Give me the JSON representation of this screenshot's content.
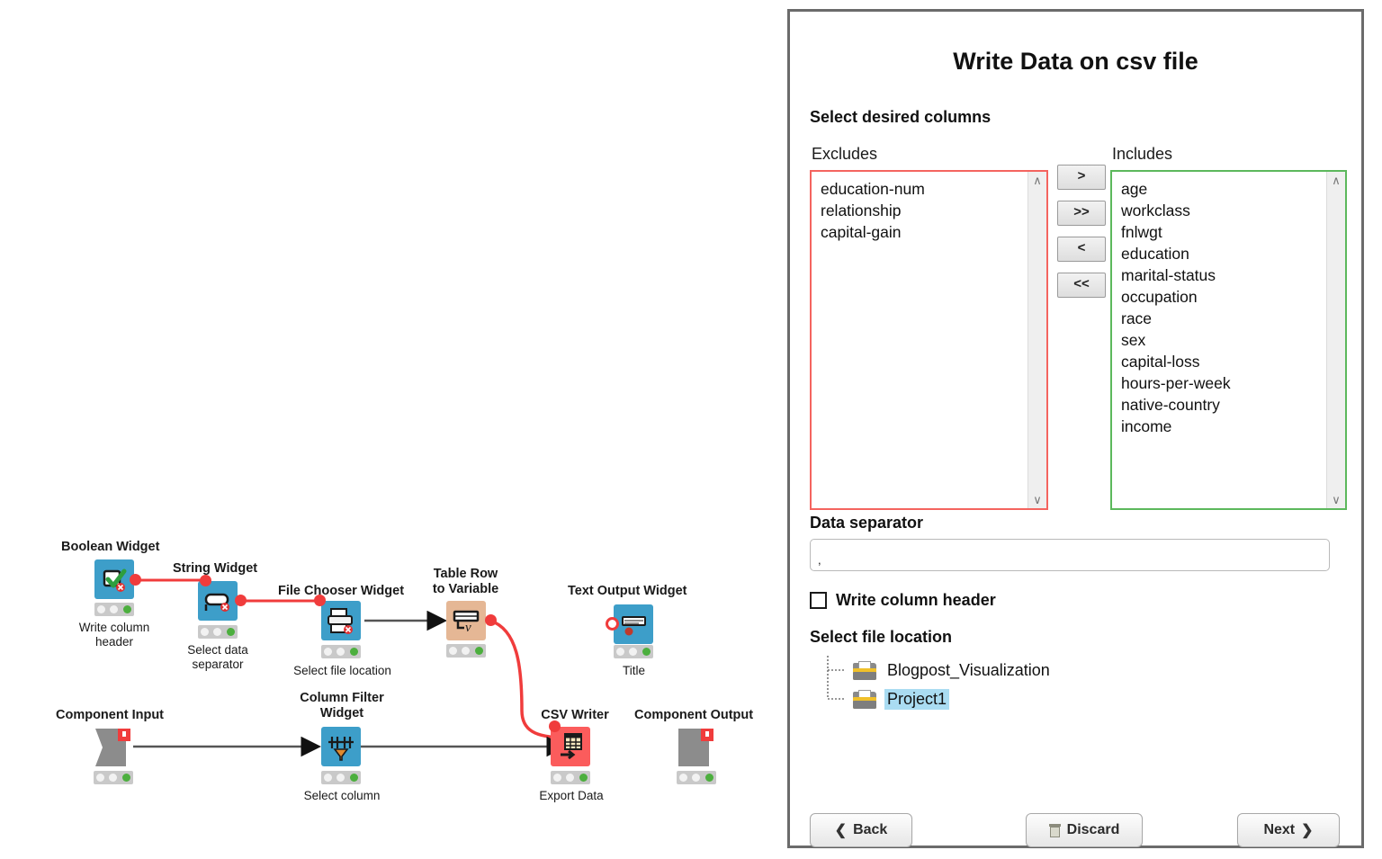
{
  "workflow": {
    "nodes": [
      {
        "id": "boolean-widget",
        "title": "Boolean Widget",
        "label": "Write column\nheader",
        "color": "blue"
      },
      {
        "id": "string-widget",
        "title": "String Widget",
        "label": "Select data\nseparator",
        "color": "blue"
      },
      {
        "id": "file-chooser-widget",
        "title": "File Chooser Widget",
        "label": "Select file location",
        "color": "blue"
      },
      {
        "id": "table-row-to-variable",
        "title": "Table Row\nto Variable",
        "label": "",
        "color": "tan"
      },
      {
        "id": "text-output-widget",
        "title": "Text Output Widget",
        "label": "Title",
        "color": "blue"
      },
      {
        "id": "component-input",
        "title": "Component Input",
        "label": "",
        "color": "gray"
      },
      {
        "id": "column-filter-widget",
        "title": "Column Filter\nWidget",
        "label": "Select column",
        "color": "blue"
      },
      {
        "id": "csv-writer",
        "title": "CSV Writer",
        "label": "Export Data",
        "color": "red"
      },
      {
        "id": "component-output",
        "title": "Component Output",
        "label": "",
        "color": "gray"
      }
    ],
    "colors": {
      "node_blue": "#3d9ec9",
      "node_tan": "#e5b795",
      "node_red": "#fb5c5c",
      "node_gray": "#8c8c8c",
      "flow_variable_connection": "#f03c3c",
      "data_connection": "#555555",
      "status_ok": "#4caf3e"
    }
  },
  "dialog": {
    "title": "Write Data on csv file",
    "columns_section": {
      "heading": "Select desired columns",
      "excludes_label": "Excludes",
      "includes_label": "Includes",
      "excludes": [
        "education-num",
        "relationship",
        "capital-gain"
      ],
      "includes": [
        "age",
        "workclass",
        "fnlwgt",
        "education",
        "marital-status",
        "occupation",
        "race",
        "sex",
        "capital-loss",
        "hours-per-week",
        "native-country",
        "income"
      ],
      "buttons": [
        ">",
        ">>",
        "<",
        "<<"
      ],
      "excludes_border_color": "#f4645f",
      "includes_border_color": "#5cb85c",
      "scroll_up_icon": "∧",
      "scroll_down_icon": "∨"
    },
    "separator": {
      "label": "Data separator",
      "value": ",",
      "placeholder": ""
    },
    "write_header": {
      "label": "Write column header",
      "checked": false
    },
    "file_location": {
      "label": "Select file location",
      "items": [
        {
          "name": "Blogpost_Visualization",
          "selected": false
        },
        {
          "name": "Project1",
          "selected": true
        }
      ],
      "selection_color": "#aadcf2"
    },
    "footer": {
      "back": "Back",
      "discard": "Discard",
      "next": "Next",
      "back_icon": "❮",
      "next_icon": "❯",
      "discard_icon": "trash-icon"
    }
  }
}
